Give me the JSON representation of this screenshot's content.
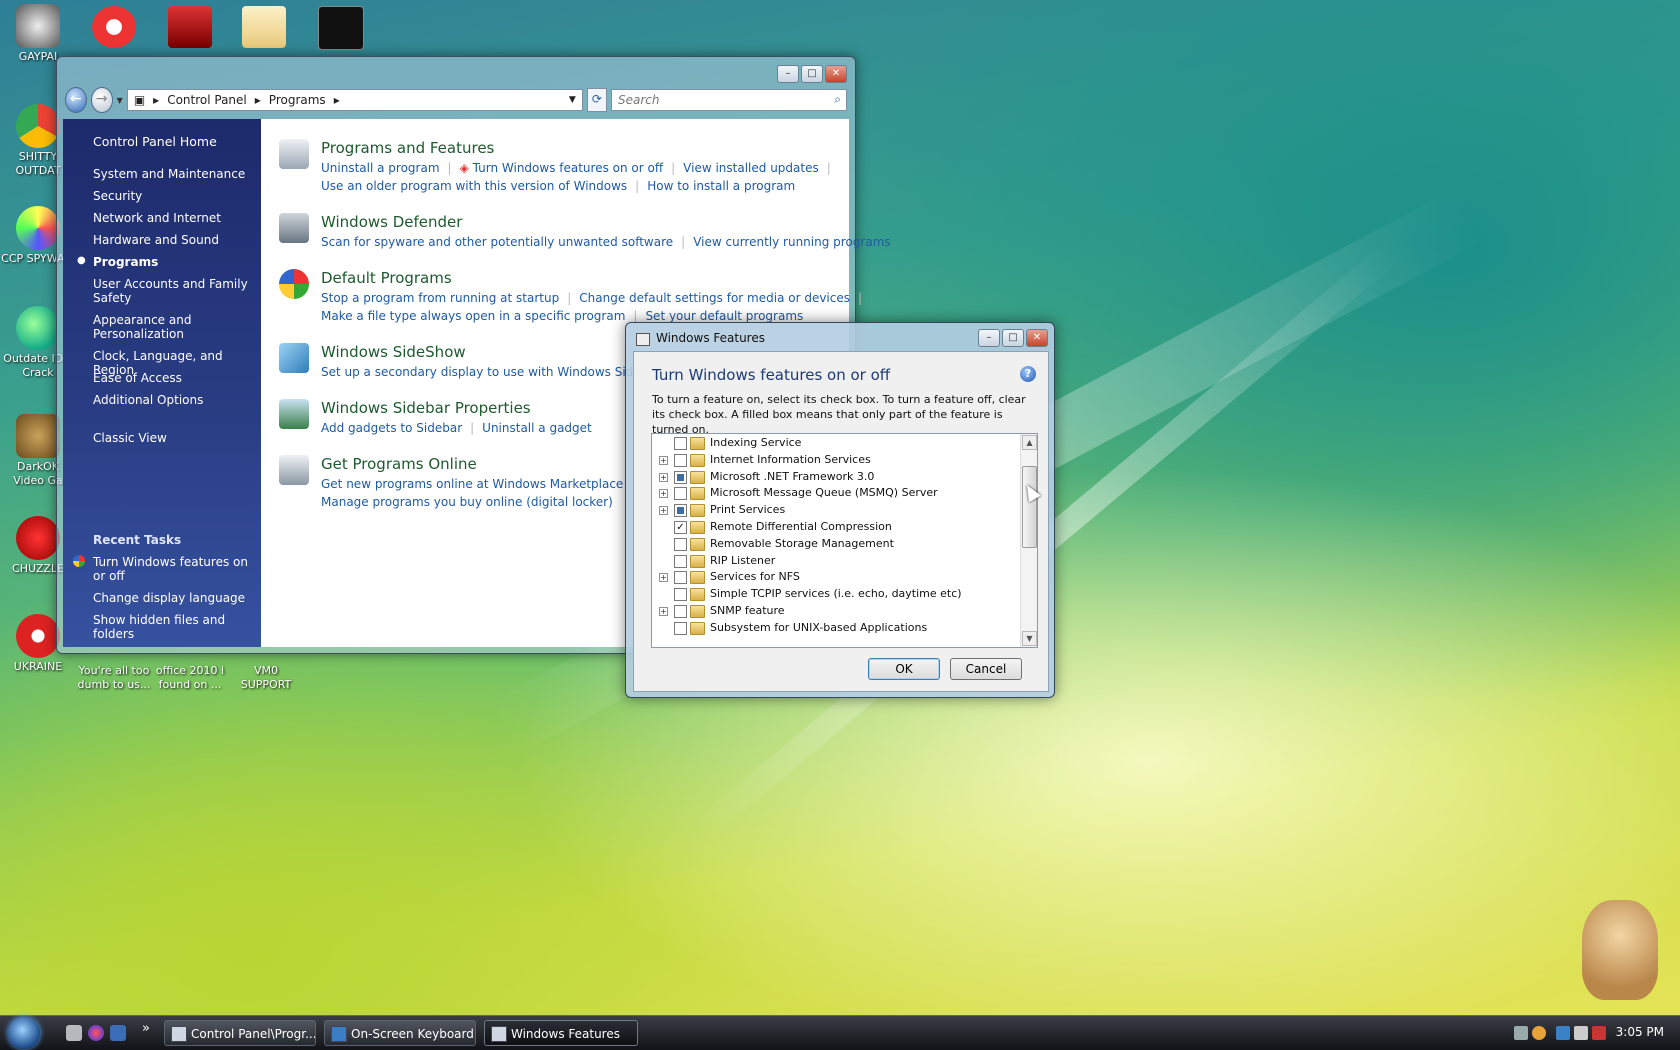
{
  "desktop": {
    "icons": [
      {
        "label": "GAYPAI"
      },
      {
        "label": "SHITTY OUTDAT"
      },
      {
        "label": "CCP SPYWA..."
      },
      {
        "label": "Outdate IDM Crack"
      },
      {
        "label": "DarkOK Video Ga"
      },
      {
        "label": "CHUZZLE"
      },
      {
        "label": "UKRAINE"
      },
      {
        "label": "You're all too dumb to us..."
      },
      {
        "label": "office 2010 i found on ..."
      },
      {
        "label": "VM0 SUPPORT"
      }
    ]
  },
  "control_panel": {
    "address": {
      "segments": [
        "Control Panel",
        "Programs"
      ]
    },
    "search": {
      "placeholder": "Search"
    },
    "sidebar": {
      "home": "Control Panel Home",
      "items": [
        "System and Maintenance",
        "Security",
        "Network and Internet",
        "Hardware and Sound",
        "Programs",
        "User Accounts and Family Safety",
        "Appearance and Personalization",
        "Clock, Language, and Region",
        "Ease of Access",
        "Additional Options"
      ],
      "classic_view": "Classic View",
      "recent_tasks_title": "Recent Tasks",
      "recent_tasks": [
        "Turn Windows features on or off",
        "Change display language",
        "Show hidden files and folders"
      ]
    },
    "categories": [
      {
        "title": "Programs and Features",
        "line1": [
          "Uninstall a program",
          "Turn Windows features on or off",
          "View installed updates"
        ],
        "line2": [
          "Use an older program with this version of Windows",
          "How to install a program"
        ]
      },
      {
        "title": "Windows Defender",
        "line1": [
          "Scan for spyware and other potentially unwanted software",
          "View currently running programs"
        ]
      },
      {
        "title": "Default Programs",
        "line1": [
          "Stop a program from running at startup",
          "Change default settings for media or devices"
        ],
        "line2": [
          "Make a file type always open in a specific program",
          "Set your default programs"
        ]
      },
      {
        "title": "Windows SideShow",
        "line1": [
          "Set up a secondary display to use with Windows SideShow"
        ]
      },
      {
        "title": "Windows Sidebar Properties",
        "line1": [
          "Add gadgets to Sidebar",
          "Uninstall a gadget"
        ]
      },
      {
        "title": "Get Programs Online",
        "line1": [
          "Get new programs online at Windows Marketplace"
        ],
        "line2": [
          "Manage programs you buy online (digital locker)"
        ]
      }
    ]
  },
  "windows_features": {
    "window_title": "Windows Features",
    "heading": "Turn Windows features on or off",
    "description": "To turn a feature on, select its check box. To turn a feature off, clear its check box. A filled box means that only part of the feature is turned on.",
    "features": [
      {
        "name": "Indexing Service",
        "expandable": false,
        "state": "off"
      },
      {
        "name": "Internet Information Services",
        "expandable": true,
        "state": "off"
      },
      {
        "name": "Microsoft .NET Framework 3.0",
        "expandable": true,
        "state": "partial"
      },
      {
        "name": "Microsoft Message Queue (MSMQ) Server",
        "expandable": true,
        "state": "off"
      },
      {
        "name": "Print Services",
        "expandable": true,
        "state": "partial"
      },
      {
        "name": "Remote Differential Compression",
        "expandable": false,
        "state": "on"
      },
      {
        "name": "Removable Storage Management",
        "expandable": false,
        "state": "off"
      },
      {
        "name": "RIP Listener",
        "expandable": false,
        "state": "off"
      },
      {
        "name": "Services for NFS",
        "expandable": true,
        "state": "off"
      },
      {
        "name": "Simple TCPIP services (i.e. echo, daytime etc)",
        "expandable": false,
        "state": "off"
      },
      {
        "name": "SNMP feature",
        "expandable": true,
        "state": "off"
      },
      {
        "name": "Subsystem for UNIX-based Applications",
        "expandable": false,
        "state": "off"
      }
    ],
    "ok_label": "OK",
    "cancel_label": "Cancel"
  },
  "taskbar": {
    "buttons": [
      {
        "label": "Control Panel\\Progr...",
        "active": false
      },
      {
        "label": "On-Screen Keyboard",
        "active": false
      },
      {
        "label": "Windows Features",
        "active": true
      }
    ],
    "overflow": "»",
    "clock": "3:05 PM"
  }
}
